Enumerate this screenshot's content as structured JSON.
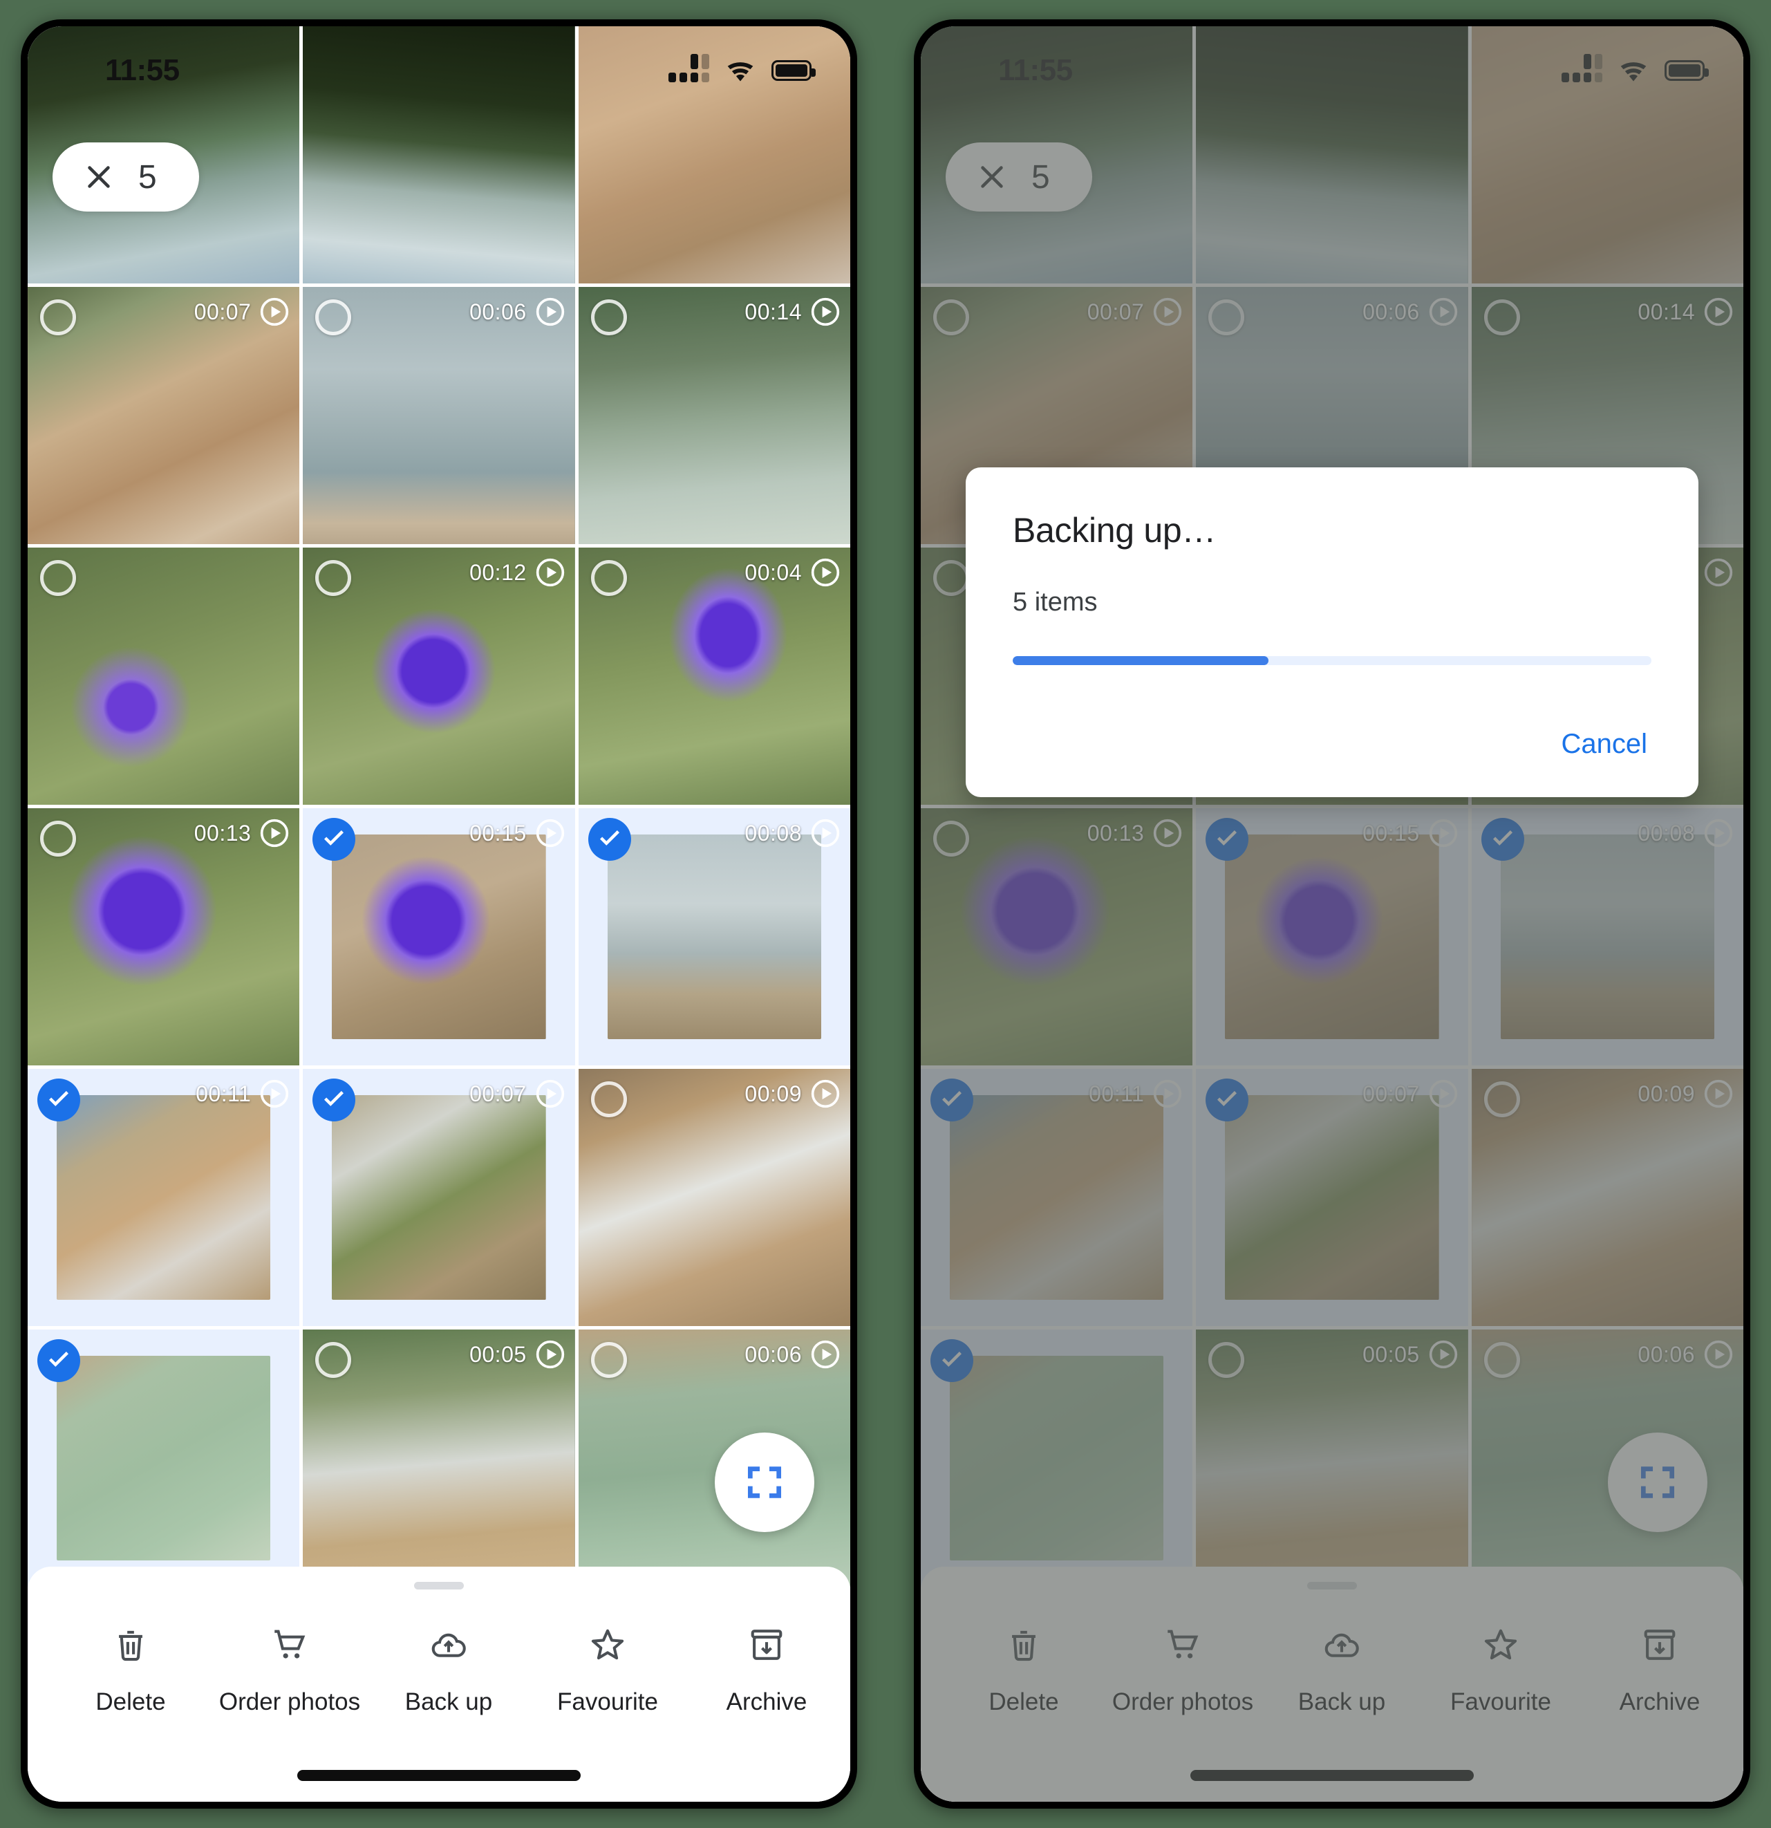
{
  "background_color": "#4e6d51",
  "accent_blue": "#1a73e8",
  "selection_blue": "#1b71e8",
  "selection_tint": "#e8f0fe",
  "status_bar": {
    "clock": "11:55",
    "cellular_icon": "cellular-signal-icon",
    "wifi_icon": "wifi-icon",
    "battery_icon": "battery-icon"
  },
  "selection_chip": {
    "close_icon": "close-icon",
    "count": "5"
  },
  "fab": {
    "icon": "lens-scan-icon"
  },
  "grid": {
    "rows": [
      [
        {
          "duration": "",
          "selected": false,
          "video": false,
          "ring": false,
          "img": "palm-lake-1"
        },
        {
          "duration": "",
          "selected": false,
          "video": false,
          "ring": false,
          "img": "palm-lake-2"
        },
        {
          "duration": "",
          "selected": false,
          "video": false,
          "ring": false,
          "img": "dirt-path-railing"
        }
      ],
      [
        {
          "duration": "00:07",
          "selected": false,
          "video": true,
          "ring": true,
          "img": "railing-lake"
        },
        {
          "duration": "00:06",
          "selected": false,
          "video": true,
          "ring": true,
          "img": "boy-at-lake"
        },
        {
          "duration": "00:14",
          "selected": false,
          "video": true,
          "ring": true,
          "img": "duck-on-water"
        }
      ],
      [
        {
          "duration": "",
          "selected": false,
          "video": false,
          "ring": true,
          "img": "purple-flower-hand-1"
        },
        {
          "duration": "00:12",
          "selected": false,
          "video": true,
          "ring": true,
          "img": "purple-flower-hand-2"
        },
        {
          "duration": "00:04",
          "selected": false,
          "video": true,
          "ring": true,
          "img": "purple-flower-hand-3"
        }
      ],
      [
        {
          "duration": "00:13",
          "selected": false,
          "video": true,
          "ring": true,
          "img": "purple-flower-hand-4"
        },
        {
          "duration": "00:15",
          "selected": true,
          "video": true,
          "ring": false,
          "img": "purple-flower-hand-5"
        },
        {
          "duration": "00:08",
          "selected": true,
          "video": true,
          "ring": false,
          "img": "duck-on-rocks"
        }
      ],
      [
        {
          "duration": "00:11",
          "selected": true,
          "video": true,
          "ring": false,
          "img": "boy-on-rocks-waterfall"
        },
        {
          "duration": "00:07",
          "selected": true,
          "video": true,
          "ring": false,
          "img": "boy-standing-waterfall"
        },
        {
          "duration": "00:09",
          "selected": false,
          "video": true,
          "ring": true,
          "img": "waterfall-rocks"
        }
      ],
      [
        {
          "duration": "",
          "selected": true,
          "video": false,
          "ring": false,
          "img": "feet-in-green-water"
        },
        {
          "duration": "00:05",
          "selected": false,
          "video": true,
          "ring": true,
          "img": "waterfall-distant"
        },
        {
          "duration": "00:06",
          "selected": false,
          "video": true,
          "ring": true,
          "img": "green-pool-water"
        }
      ]
    ]
  },
  "action_sheet": {
    "actions": [
      {
        "label": "Delete",
        "icon": "trash-icon"
      },
      {
        "label": "Order photos",
        "icon": "shopping-cart-icon"
      },
      {
        "label": "Back up",
        "icon": "cloud-upload-icon"
      },
      {
        "label": "Favourite",
        "icon": "star-outline-icon"
      },
      {
        "label": "Archive",
        "icon": "archive-box-icon"
      }
    ]
  },
  "dialog": {
    "title": "Backing up…",
    "subtitle": "5 items",
    "progress_percent": 40,
    "cancel_label": "Cancel"
  }
}
